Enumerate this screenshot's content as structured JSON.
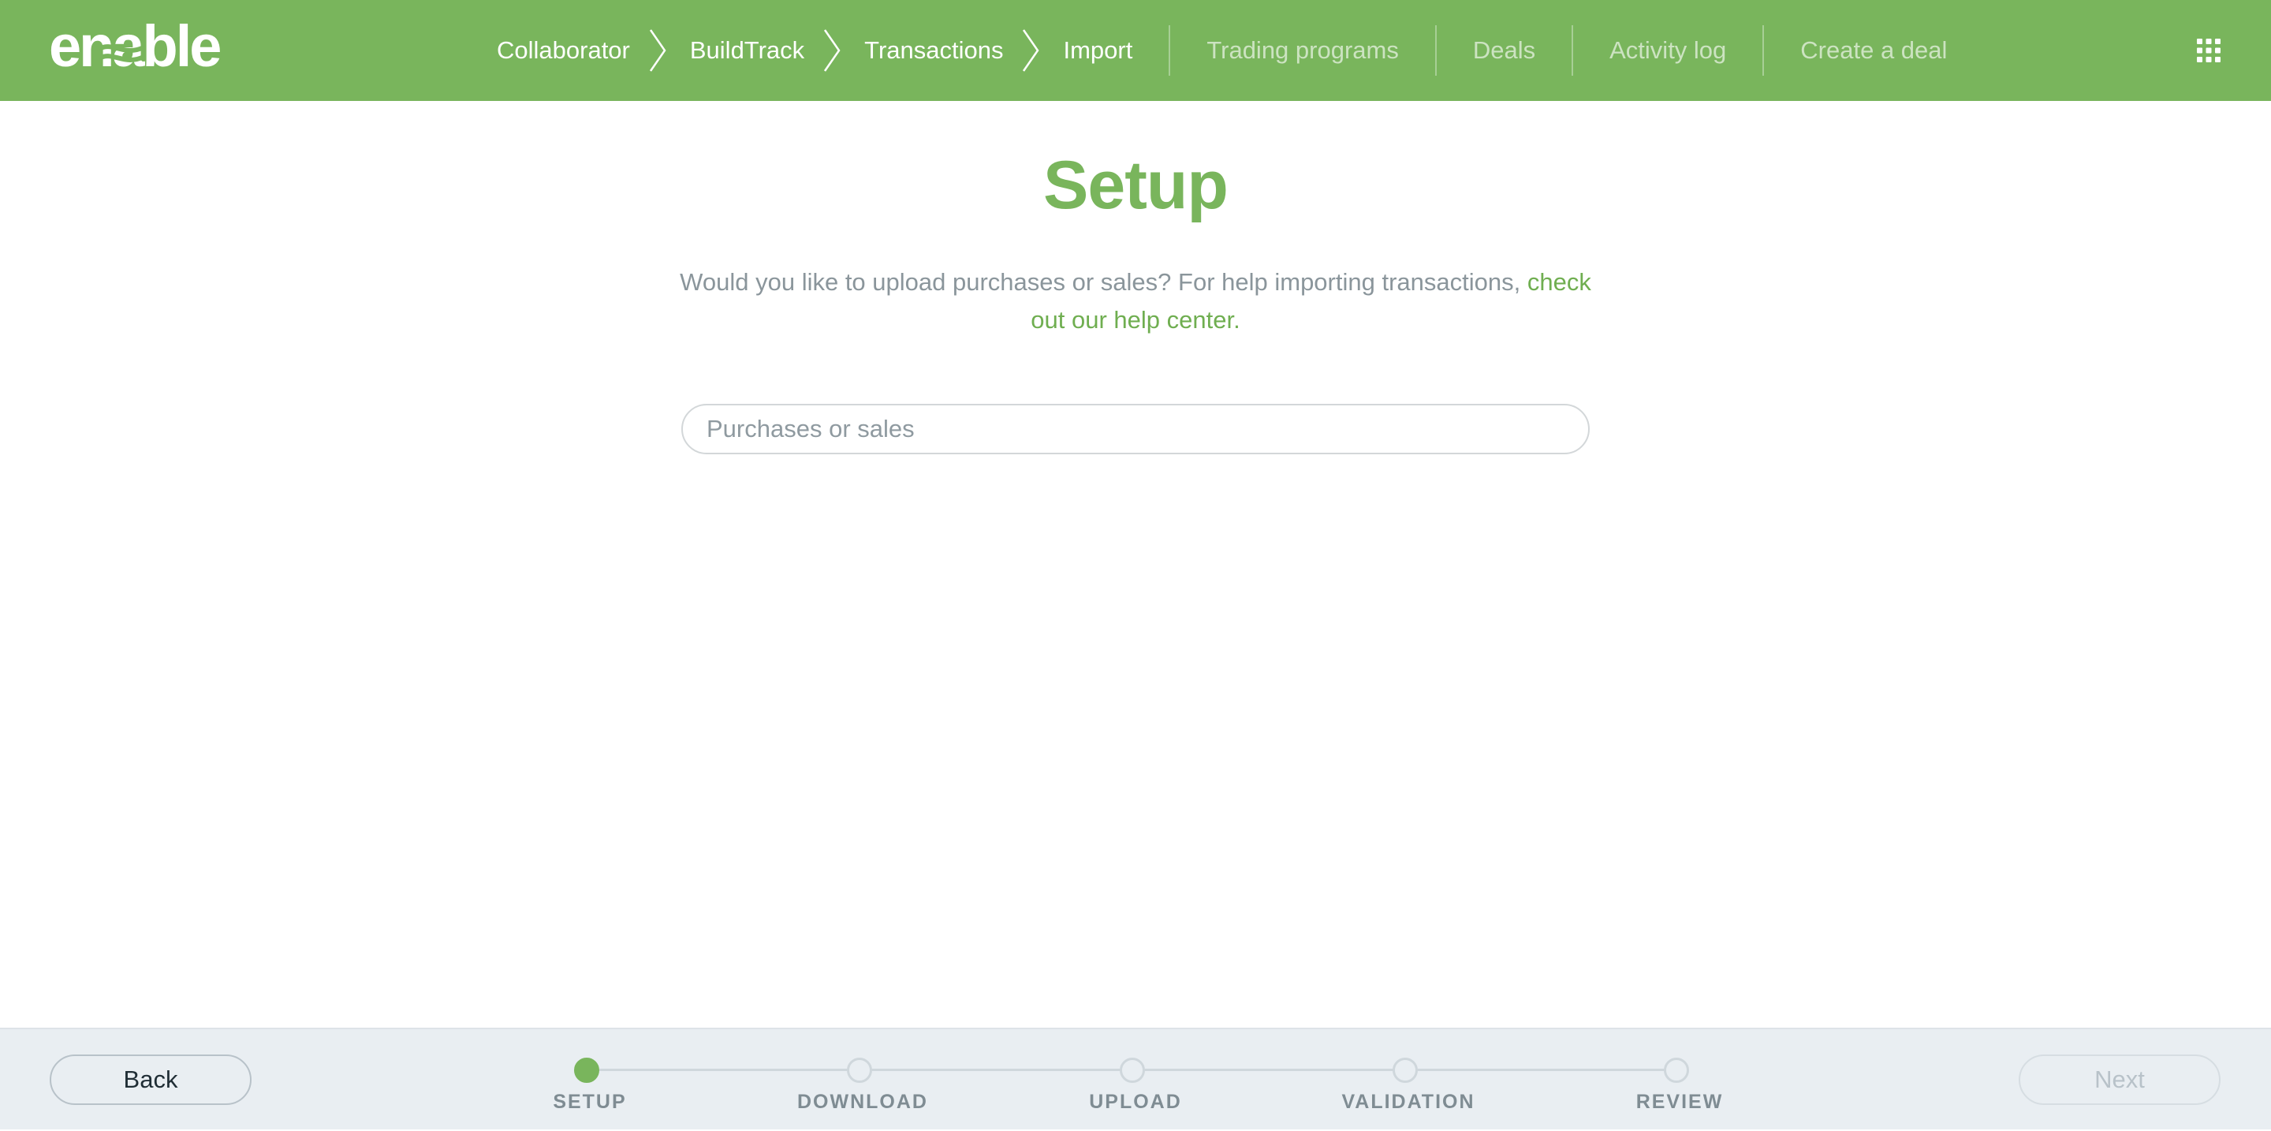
{
  "header": {
    "logo_text": "enable",
    "breadcrumbs": [
      "Collaborator",
      "BuildTrack",
      "Transactions",
      "Import"
    ],
    "nav_links": [
      "Trading programs",
      "Deals",
      "Activity log",
      "Create a deal"
    ],
    "apps_icon": "grid-icon"
  },
  "main": {
    "title": "Setup",
    "intro_text": "Would you like to upload purchases or sales? For help importing transactions, ",
    "intro_link": "check out our help center.",
    "select_placeholder": "Purchases or sales"
  },
  "footer": {
    "back_label": "Back",
    "next_label": "Next",
    "next_enabled": false,
    "steps": [
      "SETUP",
      "DOWNLOAD",
      "UPLOAD",
      "VALIDATION",
      "REVIEW"
    ],
    "active_step": 0
  },
  "colors": {
    "brand_green": "#79b55c",
    "text_gray": "#8a959b",
    "footer_bg": "#e9eef2"
  }
}
